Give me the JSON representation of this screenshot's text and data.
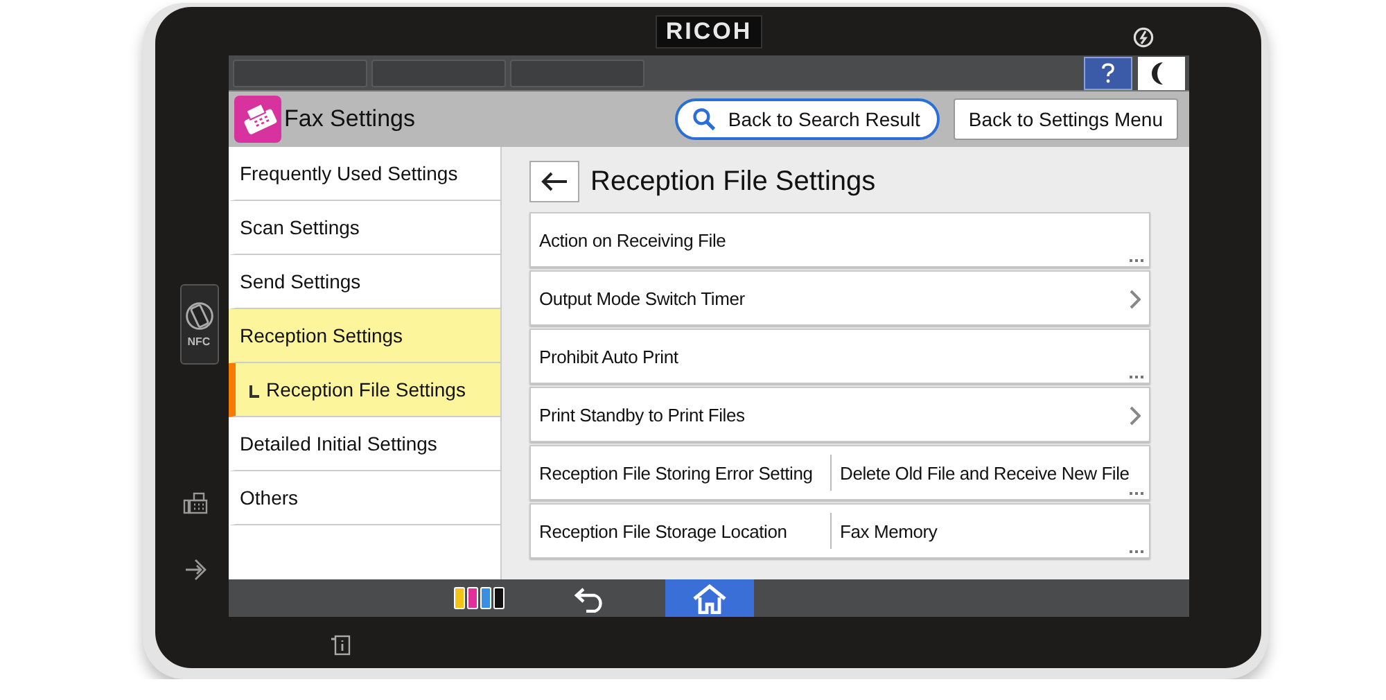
{
  "device": {
    "brand": "RICOH",
    "nfc_label": "NFC"
  },
  "header": {
    "title": "Fax Settings",
    "buttons": [
      {
        "label": "Back to Search Result",
        "kind": "search"
      },
      {
        "label": "Back to Settings Menu",
        "kind": "plain"
      }
    ]
  },
  "sidebar": {
    "items": [
      {
        "label": "Frequently Used Settings",
        "selected": false,
        "expanded": false
      },
      {
        "label": "Scan Settings",
        "selected": false,
        "expanded": false
      },
      {
        "label": "Send Settings",
        "selected": false,
        "expanded": false
      },
      {
        "label": "Reception Settings",
        "selected": false,
        "expanded": true,
        "children": [
          {
            "label": "Reception File Settings",
            "selected": true
          }
        ]
      },
      {
        "label": "Detailed Initial Settings",
        "selected": false,
        "expanded": false
      },
      {
        "label": "Others",
        "selected": false,
        "expanded": false
      }
    ]
  },
  "panel": {
    "title": "Reception File Settings",
    "rows": [
      {
        "label": "Action on Receiving File",
        "kind": "popup"
      },
      {
        "label": "Output Mode Switch Timer",
        "kind": "submenu"
      },
      {
        "label": "Prohibit Auto Print",
        "kind": "popup"
      },
      {
        "label": "Print Standby to Print Files",
        "kind": "submenu"
      },
      {
        "label": "Reception File Storing Error Setting",
        "kind": "popup",
        "value": "Delete Old File and Receive New File"
      },
      {
        "label": "Reception File Storage Location",
        "kind": "popup",
        "value": "Fax Memory"
      }
    ]
  }
}
